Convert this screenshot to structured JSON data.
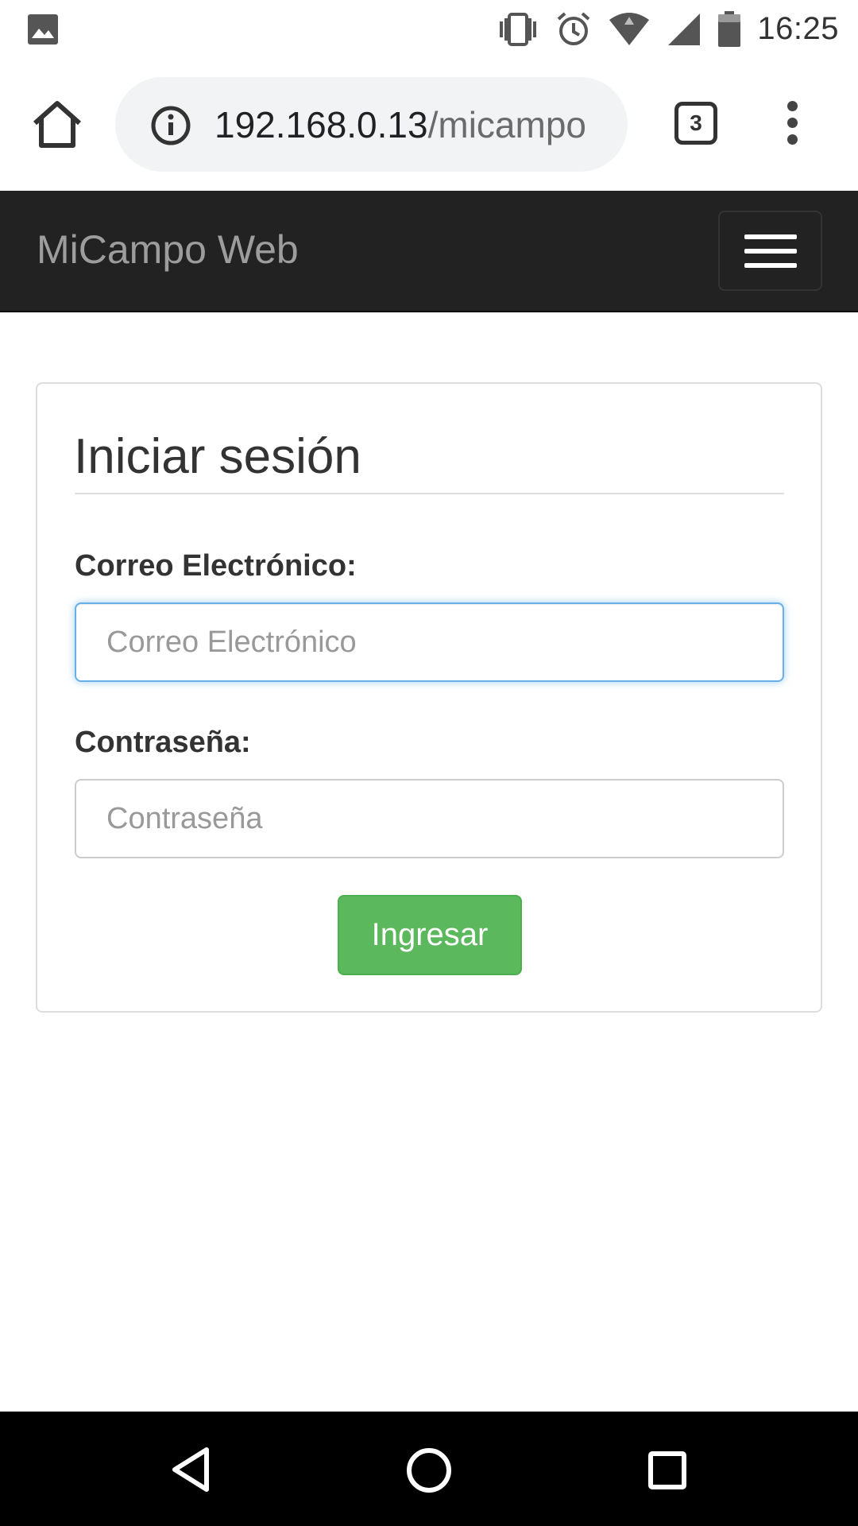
{
  "status_bar": {
    "time": "16:25",
    "icons": [
      "image-icon",
      "vibrate-icon",
      "alarm-icon",
      "wifi-icon",
      "signal-icon",
      "battery-icon"
    ]
  },
  "browser": {
    "url_host": "192.168.0.13",
    "url_path": "/micampo",
    "tab_count": "3",
    "icons": [
      "home-icon",
      "info-icon",
      "tabs-icon",
      "more-vert-icon"
    ]
  },
  "navbar": {
    "brand": "MiCampo Web",
    "icons": [
      "hamburger-icon"
    ]
  },
  "login": {
    "title": "Iniciar sesión",
    "email_label": "Correo Electrónico:",
    "email_placeholder": "Correo Electrónico",
    "email_value": "",
    "password_label": "Contraseña:",
    "password_placeholder": "Contraseña",
    "password_value": "",
    "submit_label": "Ingresar"
  },
  "android_nav": {
    "icons": [
      "back-icon",
      "home-circle-icon",
      "recents-icon"
    ]
  },
  "colors": {
    "navbar_bg": "#222222",
    "brand_text": "#9d9d9d",
    "focus_border": "#66afe9",
    "success_button": "#5cb85c"
  }
}
